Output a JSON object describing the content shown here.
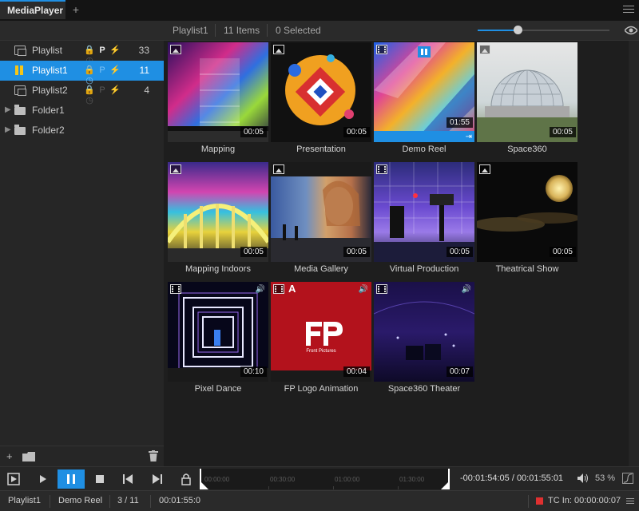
{
  "app": {
    "tab_title": "MediaPlayer",
    "add_tab": "+"
  },
  "sidebar": {
    "items": [
      {
        "label": "Playlist",
        "count": "33",
        "flags": [
          "🔒",
          "P",
          "⚡",
          "◷"
        ],
        "selected": false
      },
      {
        "label": "Playlist1",
        "count": "11",
        "flags": [
          "🔒",
          "P",
          "⚡",
          "◷"
        ],
        "selected": true
      },
      {
        "label": "Playlist2",
        "count": "4",
        "flags": [
          "🔒",
          "P",
          "⚡",
          "◷"
        ],
        "selected": false
      },
      {
        "label": "Folder1"
      },
      {
        "label": "Folder2"
      }
    ],
    "add_label": "+"
  },
  "header": {
    "playlist_name": "Playlist1",
    "items_count": "11 Items",
    "selected_count": "0 Selected",
    "zoom_level": 0.3
  },
  "grid": {
    "items": [
      {
        "title": "Mapping",
        "duration": "00:05",
        "type": "image",
        "audio": false,
        "playing": false
      },
      {
        "title": "Presentation",
        "duration": "00:05",
        "type": "image",
        "audio": false,
        "playing": false
      },
      {
        "title": "Demo Reel",
        "duration": "01:55",
        "type": "video",
        "audio": false,
        "playing": true
      },
      {
        "title": "Space360",
        "duration": "00:05",
        "type": "image",
        "audio": false,
        "playing": false
      },
      {
        "title": "Mapping Indoors",
        "duration": "00:05",
        "type": "image",
        "audio": false,
        "playing": false
      },
      {
        "title": "Media Gallery",
        "duration": "00:05",
        "type": "image",
        "audio": false,
        "playing": false
      },
      {
        "title": "Virtual Production",
        "duration": "00:05",
        "type": "video",
        "audio": false,
        "playing": false
      },
      {
        "title": "Theatrical Show",
        "duration": "00:05",
        "type": "image",
        "audio": false,
        "playing": false
      },
      {
        "title": "Pixel Dance",
        "duration": "00:10",
        "type": "video",
        "audio": true,
        "playing": false
      },
      {
        "title": "FP Logo Animation",
        "duration": "00:04",
        "type": "video",
        "audio": true,
        "playing": false,
        "badge": "A",
        "logo_text": "Front Pictures"
      },
      {
        "title": "Space360 Theater",
        "duration": "00:07",
        "type": "video",
        "audio": true,
        "playing": false
      }
    ]
  },
  "transport": {
    "timeline_ticks": [
      "00:00:00",
      "00:30:00",
      "01:00:00",
      "01:30:00"
    ],
    "time_readout": "-00:01:54:05 / 00:01:55:01",
    "volume": "53 %"
  },
  "status": {
    "playlist": "Playlist1",
    "item": "Demo Reel",
    "position": "3 / 11",
    "duration": "00:01:55:0",
    "tc_label": "TC In:",
    "tc_value": "00:00:00:07"
  },
  "colors": {
    "accent": "#1f8fe3",
    "playing_indicator": "#f5c518",
    "tc_indicator": "#e03030"
  }
}
